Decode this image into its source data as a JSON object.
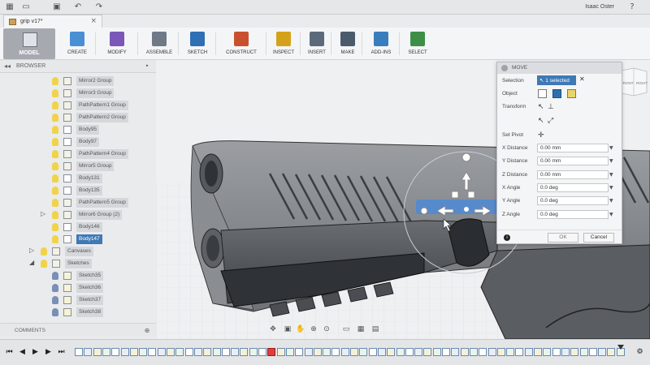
{
  "titlebar": {
    "user": "Isaac Oster",
    "help_label": "?"
  },
  "doc_tab": {
    "title": "grip v17*",
    "close_label": "×"
  },
  "toolbar": {
    "workspace_label": "MODEL",
    "tools": [
      {
        "label": "CREATE",
        "color": "#4a8fd4"
      },
      {
        "label": "MODIFY",
        "color": "#7a57b8"
      },
      {
        "label": "ASSEMBLE",
        "color": "#6f7a86"
      },
      {
        "label": "SKETCH",
        "color": "#2f6fb3"
      },
      {
        "label": "CONSTRUCT",
        "color": "#c9502e"
      },
      {
        "label": "INSPECT",
        "color": "#d4a21a"
      },
      {
        "label": "INSERT",
        "color": "#5a6a7a"
      },
      {
        "label": "MAKE",
        "color": "#4b5b6b"
      },
      {
        "label": "ADD-INS",
        "color": "#3a7dbd"
      },
      {
        "label": "SELECT",
        "color": "#3d8f45"
      }
    ]
  },
  "browser": {
    "title": "BROWSER",
    "items": [
      {
        "label": "Mirror2 Group",
        "kind": "group"
      },
      {
        "label": "Mirror3 Group",
        "kind": "group"
      },
      {
        "label": "PathPattern1 Group",
        "kind": "group"
      },
      {
        "label": "PathPattern2 Group",
        "kind": "group"
      },
      {
        "label": "Body95",
        "kind": "body"
      },
      {
        "label": "Body97",
        "kind": "body"
      },
      {
        "label": "PathPattern4 Group",
        "kind": "group"
      },
      {
        "label": "Mirror5 Group",
        "kind": "group"
      },
      {
        "label": "Body131",
        "kind": "body"
      },
      {
        "label": "Body135",
        "kind": "body"
      },
      {
        "label": "PathPattern5 Group",
        "kind": "group"
      },
      {
        "label": "Mirror6 Group (2)",
        "kind": "group"
      },
      {
        "label": "Body146",
        "kind": "body"
      },
      {
        "label": "Body147",
        "kind": "body",
        "selected": true
      }
    ],
    "folders": [
      {
        "label": "Canvases"
      },
      {
        "label": "Sketches"
      }
    ],
    "sketches": [
      {
        "label": "Sketch35"
      },
      {
        "label": "Sketch36"
      },
      {
        "label": "Sketch37"
      },
      {
        "label": "Sketch38"
      }
    ]
  },
  "comments": {
    "label": "COMMENTS"
  },
  "view_cube": {
    "front": "FRONT",
    "right": "RIGHT"
  },
  "move_dialog": {
    "title": "MOVE",
    "selection_label": "Selection",
    "selection_value": "1 selected",
    "object_label": "Object",
    "transform_label": "Transform",
    "set_pivot_label": "Set Pivot",
    "fields": [
      {
        "label": "X Distance",
        "value": "0.00 mm"
      },
      {
        "label": "Y Distance",
        "value": "0.00 mm"
      },
      {
        "label": "Z Distance",
        "value": "0.00 mm"
      },
      {
        "label": "X Angle",
        "value": "0.0 deg"
      },
      {
        "label": "Y Angle",
        "value": "0.0 deg"
      },
      {
        "label": "Z Angle",
        "value": "0.0 deg"
      }
    ],
    "ok_label": "OK",
    "cancel_label": "Cancel",
    "info_label": "i"
  },
  "colors": {
    "accent": "#3f79b5",
    "bulb": "#f1d34a",
    "bulb_sketch": "#7a8fb5"
  }
}
